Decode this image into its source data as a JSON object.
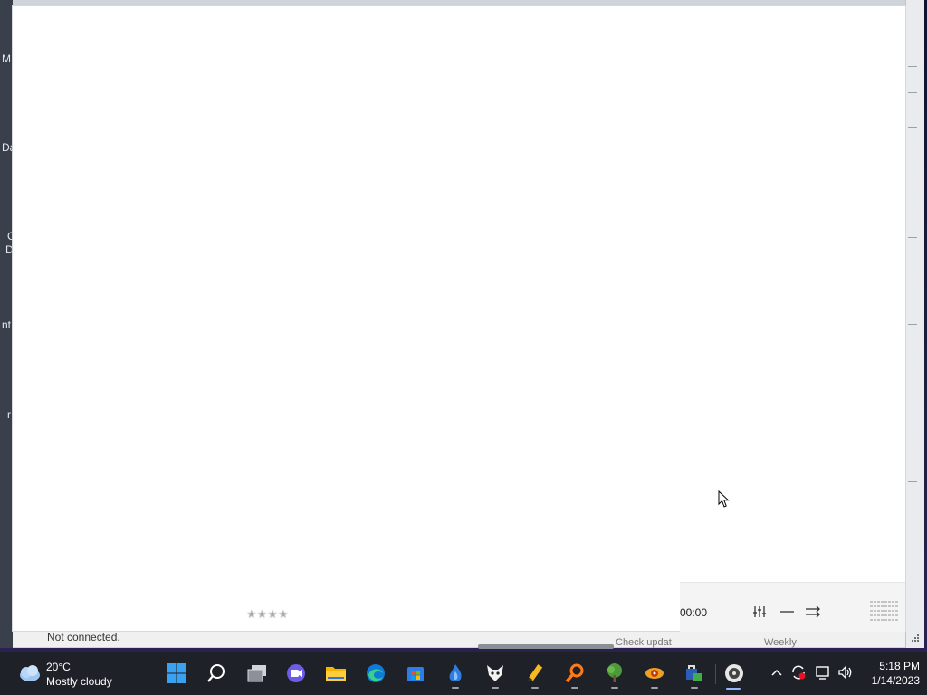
{
  "background_window": {
    "left_fragments": [
      "M",
      "Da",
      "C",
      "D",
      "nt",
      "r"
    ],
    "status_text": "Not connected.",
    "bottom_left_option": "Check updat",
    "bottom_right_option": "Weekly"
  },
  "player": {
    "time": "00:00",
    "rating": "★★★★"
  },
  "taskbar": {
    "weather": {
      "temperature": "20°C",
      "condition": "Mostly cloudy"
    },
    "apps": [
      {
        "name": "start"
      },
      {
        "name": "search"
      },
      {
        "name": "task-view"
      },
      {
        "name": "chat"
      },
      {
        "name": "file-explorer"
      },
      {
        "name": "edge"
      },
      {
        "name": "store"
      },
      {
        "name": "app-blue"
      },
      {
        "name": "app-fox"
      },
      {
        "name": "app-pencil"
      },
      {
        "name": "app-search-orange"
      },
      {
        "name": "app-tree"
      },
      {
        "name": "app-sun"
      },
      {
        "name": "app-lock"
      },
      {
        "name": "app-active"
      }
    ],
    "clock": {
      "time": "5:18 PM",
      "date": "1/14/2023"
    }
  }
}
